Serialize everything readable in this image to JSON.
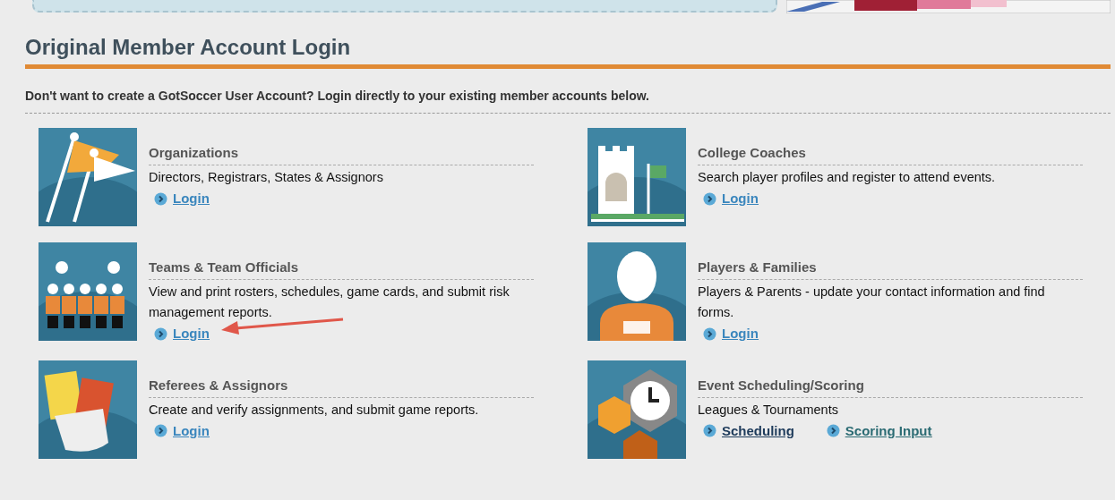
{
  "heading": "Original Member Account Login",
  "intro": "Don't want to create a GotSoccer User Account? Login directly to your existing member accounts below.",
  "accounts": [
    {
      "title": "Organizations",
      "description": "Directors, Registrars, States & Assignors",
      "links": [
        {
          "label": "Login",
          "color": "#3a86bd"
        }
      ]
    },
    {
      "title": "College Coaches",
      "description": "Search player profiles and register to attend events.",
      "links": [
        {
          "label": "Login",
          "color": "#3a86bd"
        }
      ]
    },
    {
      "title": "Teams & Team Officials",
      "description": "View and print rosters, schedules, game cards, and submit risk management reports.",
      "links": [
        {
          "label": "Login",
          "color": "#3a86bd"
        }
      ]
    },
    {
      "title": "Players & Families",
      "description": "Players & Parents - update your contact information and find forms.",
      "links": [
        {
          "label": "Login",
          "color": "#3a86bd"
        }
      ]
    },
    {
      "title": "Referees & Assignors",
      "description": "Create and verify assignments, and submit game reports.",
      "links": [
        {
          "label": "Login",
          "color": "#3a86bd"
        }
      ]
    },
    {
      "title": "Event Scheduling/Scoring",
      "description": "Leagues & Tournaments",
      "links": [
        {
          "label": "Scheduling",
          "color": "#1d3a5a"
        },
        {
          "label": "Scoring Input",
          "color": "#2b6b73"
        }
      ]
    }
  ]
}
